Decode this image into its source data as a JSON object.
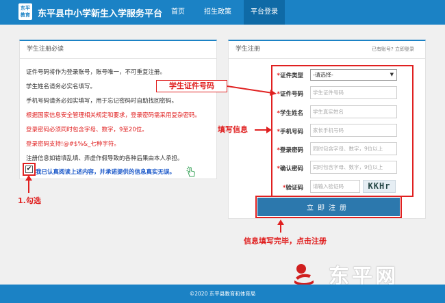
{
  "header": {
    "logo_text": "东平教育",
    "site_title": "东平县中小学新生入学服务平台",
    "nav": [
      "首页",
      "招生政策",
      "平台登录"
    ]
  },
  "notice": {
    "title": "学生注册必读",
    "lines": [
      "证件号码将作为登录账号，账号唯一，不可重复注册。",
      "学生姓名请务必实名填写。",
      "手机号码请务必如实填写，用于忘记密码时自助找回密码。",
      "根据国家信息安全管理相关规定和要求，登录密码需采用复杂密码。",
      "登录密码必须同时包含字母、数字，9至20位。",
      "登录密码支持!@#$%&_七种字符。",
      "注册信息如错填乱填、弄虚作假导致的各种后果由本人承担。"
    ],
    "agree": "我已认真阅读上述内容，并承诺提供的信息真实无误。",
    "checkbox_mark": "✔"
  },
  "register": {
    "title": "学生注册",
    "has_account": "已有账号?",
    "login_link": "立即登录",
    "star": "*",
    "id_type_label": "证件类型",
    "id_type_value": "-请选择-",
    "id_no_label": "证件号码",
    "id_no_placeholder": "学生证件号码",
    "name_label": "学生姓名",
    "name_placeholder": "学生真实姓名",
    "phone_label": "手机号码",
    "phone_placeholder": "家长手机号码",
    "pwd_label": "登录密码",
    "pwd_placeholder": "同时包含字母、数字，9位以上",
    "pwd2_label": "确认密码",
    "pwd2_placeholder": "同时包含字母、数字，9位以上",
    "captcha_label": "验证码",
    "captcha_placeholder": "请输入验证码",
    "captcha_text": "KKHr",
    "submit": "立即注册"
  },
  "annotations": {
    "id_callout": "学生证件号码",
    "fill_info": "填写信息",
    "check": "1.勾选",
    "submit_note": "信息填写完毕，点击注册"
  },
  "watermark": "东平网",
  "footer": "©2020  东平县教育和体育局",
  "colors": {
    "brand": "#1b82c5",
    "button": "#2c78ad",
    "annotation": "#e02020",
    "agree_text": "#1b58c9"
  }
}
